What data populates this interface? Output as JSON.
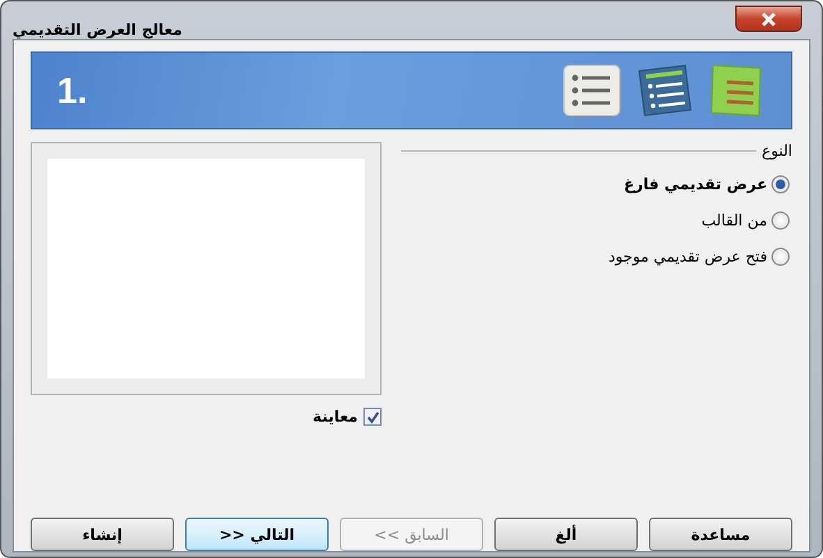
{
  "window": {
    "title": "معالج العرض التقديمي"
  },
  "banner": {
    "step": "1."
  },
  "type_group": {
    "label": "النوع",
    "options": [
      {
        "label": "عرض تقديمي فارغ",
        "selected": true
      },
      {
        "label": "من القالب",
        "selected": false
      },
      {
        "label": "فتح عرض تقديمي موجود",
        "selected": false
      }
    ]
  },
  "preview": {
    "label": "معاينة",
    "checked": true
  },
  "buttons": [
    {
      "label": "مساعدة",
      "disabled": false,
      "default": false
    },
    {
      "label": "ألغ",
      "disabled": false,
      "default": false
    },
    {
      "label": "<< السابق",
      "disabled": true,
      "default": false
    },
    {
      "label": ">> التالي",
      "disabled": false,
      "default": true
    },
    {
      "label": "إنشاء",
      "disabled": false,
      "default": false
    }
  ]
}
